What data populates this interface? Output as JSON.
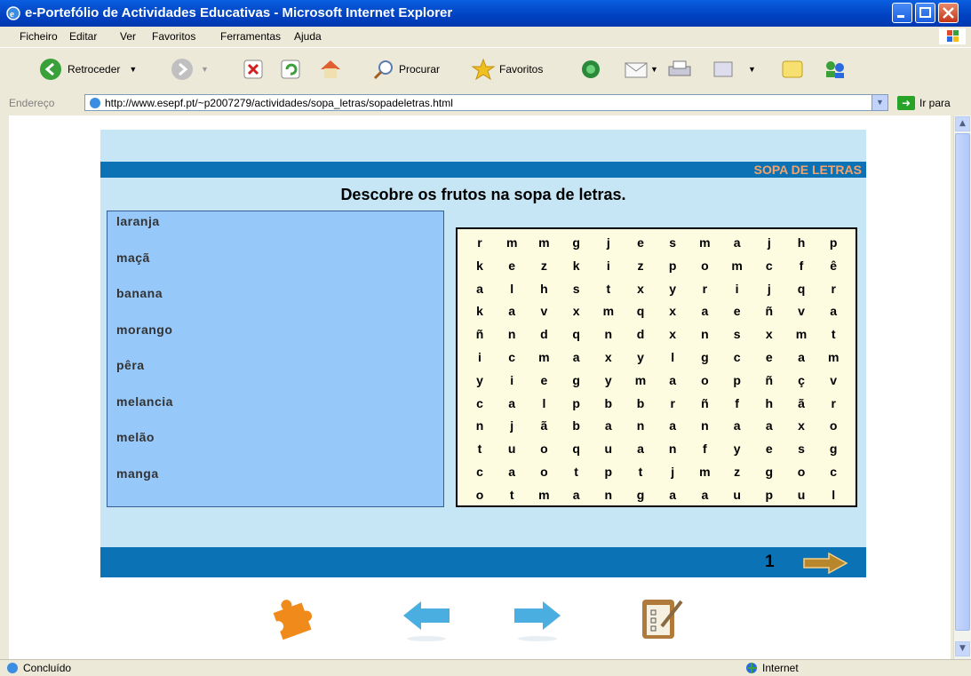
{
  "window": {
    "title": "e-Portefólio de Actividades Educativas - Microsoft Internet Explorer"
  },
  "menu": [
    "Ficheiro",
    "Editar",
    "Ver",
    "Favoritos",
    "Ferramentas",
    "Ajuda"
  ],
  "toolbar": {
    "back_label": "Retroceder",
    "search_label": "Procurar",
    "favorites_label": "Favoritos"
  },
  "address": {
    "label": "Endereço",
    "url": "http://www.esepf.pt/~p2007279/actividades/sopa_letras/sopadeletras.html",
    "go_label": "Ir para"
  },
  "page": {
    "banner": "SOPA DE LETRAS",
    "instruction": "Descobre os frutos na sopa de letras.",
    "words": [
      "laranja",
      "maçã",
      "banana",
      "morango",
      "pêra",
      "melancia",
      "melão",
      "manga"
    ],
    "grid": [
      [
        "r",
        "m",
        "m",
        "g",
        "j",
        "e",
        "s",
        "m",
        "a",
        "j",
        "h",
        "p"
      ],
      [
        "k",
        "e",
        "z",
        "k",
        "i",
        "z",
        "p",
        "o",
        "m",
        "c",
        "f",
        "ê"
      ],
      [
        "a",
        "l",
        "h",
        "s",
        "t",
        "x",
        "y",
        "r",
        "i",
        "j",
        "q",
        "r"
      ],
      [
        "k",
        "a",
        "v",
        "x",
        "m",
        "q",
        "x",
        "a",
        "e",
        "ñ",
        "v",
        "a"
      ],
      [
        "ñ",
        "n",
        "d",
        "q",
        "n",
        "d",
        "x",
        "n",
        "s",
        "x",
        "m",
        "t"
      ],
      [
        "i",
        "c",
        "m",
        "a",
        "x",
        "y",
        "l",
        "g",
        "c",
        "e",
        "a",
        "m"
      ],
      [
        "y",
        "i",
        "e",
        "g",
        "y",
        "m",
        "a",
        "o",
        "p",
        "ñ",
        "ç",
        "v"
      ],
      [
        "c",
        "a",
        "l",
        "p",
        "b",
        "b",
        "r",
        "ñ",
        "f",
        "h",
        "ã",
        "r"
      ],
      [
        "n",
        "j",
        "ã",
        "b",
        "a",
        "n",
        "a",
        "n",
        "a",
        "a",
        "x",
        "o"
      ],
      [
        "t",
        "u",
        "o",
        "q",
        "u",
        "a",
        "n",
        "f",
        "y",
        "e",
        "s",
        "g"
      ],
      [
        "c",
        "a",
        "o",
        "t",
        "p",
        "t",
        "j",
        "m",
        "z",
        "g",
        "o",
        "c"
      ],
      [
        "o",
        "t",
        "m",
        "a",
        "n",
        "g",
        "a",
        "a",
        "u",
        "p",
        "u",
        "l"
      ]
    ],
    "page_number": "1"
  },
  "status": {
    "left": "Concluído",
    "zone": "Internet"
  },
  "colors": {
    "band": "#0a72b5",
    "panel": "#c6e6f5",
    "wordlist": "#96c8f9",
    "grid_bg": "#fefce0",
    "banner_text": "#f4a46a"
  },
  "icons": [
    "ie-icon",
    "back-icon",
    "forward-icon",
    "stop-icon",
    "refresh-icon",
    "home-icon",
    "search-icon",
    "favorites-star-icon",
    "media-icon",
    "mail-icon",
    "print-icon",
    "puzzle-icon",
    "arrow-left-icon",
    "arrow-right-icon",
    "clipboard-icon",
    "next-arrow-icon"
  ]
}
